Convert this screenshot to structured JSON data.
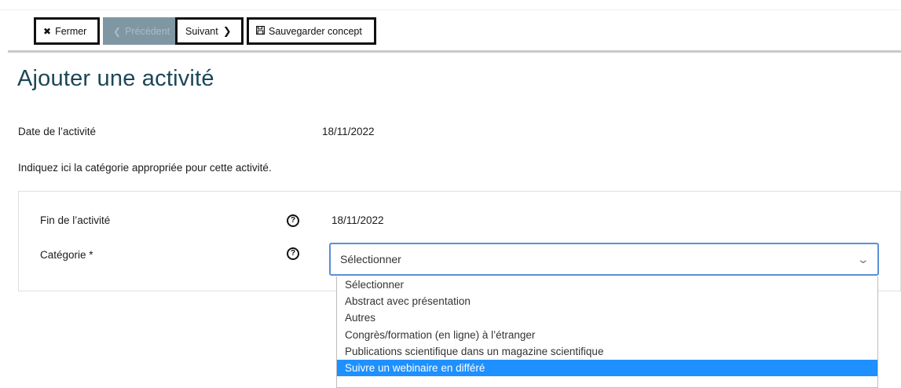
{
  "toolbar": {
    "close_label": "Fermer",
    "close_icon": "times-icon",
    "prev_label": "Précédent",
    "prev_icon": "chevron-left-icon",
    "next_label": "Suivant",
    "next_icon": "chevron-right-icon",
    "save_label": "Sauvegarder concept",
    "save_icon": "floppy-disk-icon"
  },
  "page_title": "Ajouter une activité",
  "activity_date": {
    "label": "Date de l’activité",
    "value": "18/11/2022"
  },
  "info_text": "Indiquez ici la catégorie appropriée pour cette activité.",
  "form": {
    "end": {
      "label": "Fin de l’activité",
      "value": "18/11/2022"
    },
    "category": {
      "label": "Catégorie *",
      "selected": "Sélectionner",
      "options": [
        "Sélectionner",
        "Abstract avec présentation",
        "Autres",
        "Congrès/formation (en ligne) à l’étranger",
        "Publications scientifique dans un magazine scientifique",
        "Suivre un webinaire en différé"
      ],
      "highlighted_index": 5
    }
  },
  "colors": {
    "title": "#1c4757",
    "prev_disabled_bg": "#7f97a3",
    "select_border": "#5a8fd6",
    "option_highlight": "#1e90ff"
  }
}
